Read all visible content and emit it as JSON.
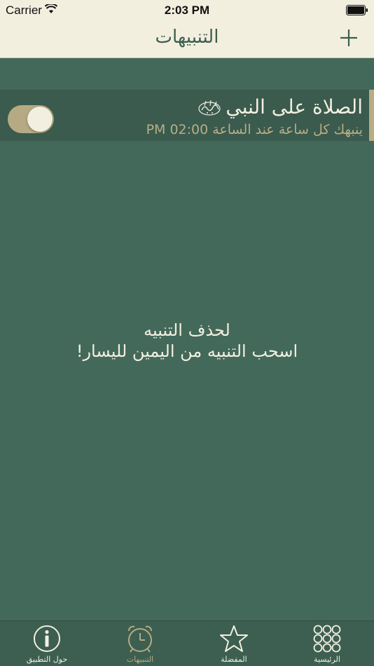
{
  "status_bar": {
    "carrier": "Carrier",
    "time": "2:03 PM"
  },
  "nav": {
    "title": "التنبيهات",
    "add_icon": "plus-icon"
  },
  "alert": {
    "title": "الصلاة على النبي",
    "subtitle": "ينبهك كل ساعة عند الساعة 02:00 PM",
    "enabled": true
  },
  "hint": {
    "line1": "لحذف التنبيه",
    "line2": "اسحب التنبيه من اليمين لليسار!"
  },
  "tabs": [
    {
      "label": "حول التطبيق",
      "icon": "info-icon",
      "active": false
    },
    {
      "label": "التنبيهات",
      "icon": "alarm-clock-icon",
      "active": true
    },
    {
      "label": "المفضلة",
      "icon": "star-icon",
      "active": false
    },
    {
      "label": "الرئيسية",
      "icon": "grid-icon",
      "active": false
    }
  ],
  "colors": {
    "background": "#43695a",
    "bar": "#f2efdf",
    "accent": "#b5aa84",
    "text_light": "#f3efe0"
  }
}
